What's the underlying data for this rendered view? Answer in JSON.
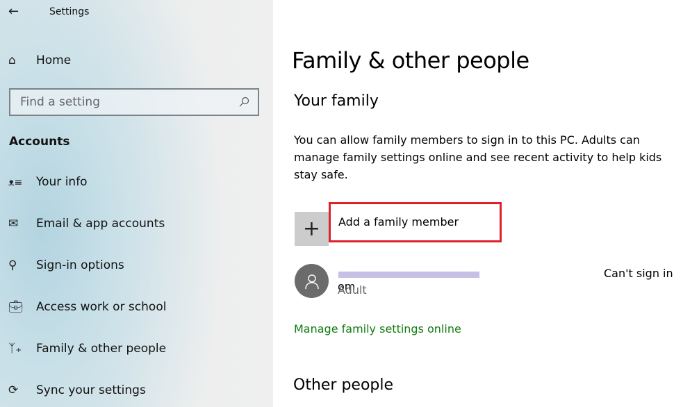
{
  "window": {
    "title": "Settings",
    "back_icon": "arrow-left-icon"
  },
  "sidebar": {
    "home": "Home",
    "search_placeholder": "Find a setting",
    "section": "Accounts",
    "items": [
      {
        "label": "Your info",
        "icon": "person-list-icon"
      },
      {
        "label": "Email & app accounts",
        "icon": "mail-icon"
      },
      {
        "label": "Sign-in options",
        "icon": "key-icon"
      },
      {
        "label": "Access work or school",
        "icon": "briefcase-icon"
      },
      {
        "label": "Family & other people",
        "icon": "person-add-icon"
      },
      {
        "label": "Sync your settings",
        "icon": "sync-icon"
      }
    ]
  },
  "main": {
    "title": "Family & other people",
    "your_family": "Your family",
    "description": "You can allow family members to sign in to this PC. Adults can manage family settings online and see recent activity to help kids stay safe.",
    "add_member": "Add a family member",
    "member": {
      "email_visible": "om",
      "role": "Adult",
      "status": "Can't sign in"
    },
    "manage_link": "Manage family settings online",
    "other_people": "Other people",
    "highlight_color": "#e0202a",
    "link_color": "#107c10"
  }
}
